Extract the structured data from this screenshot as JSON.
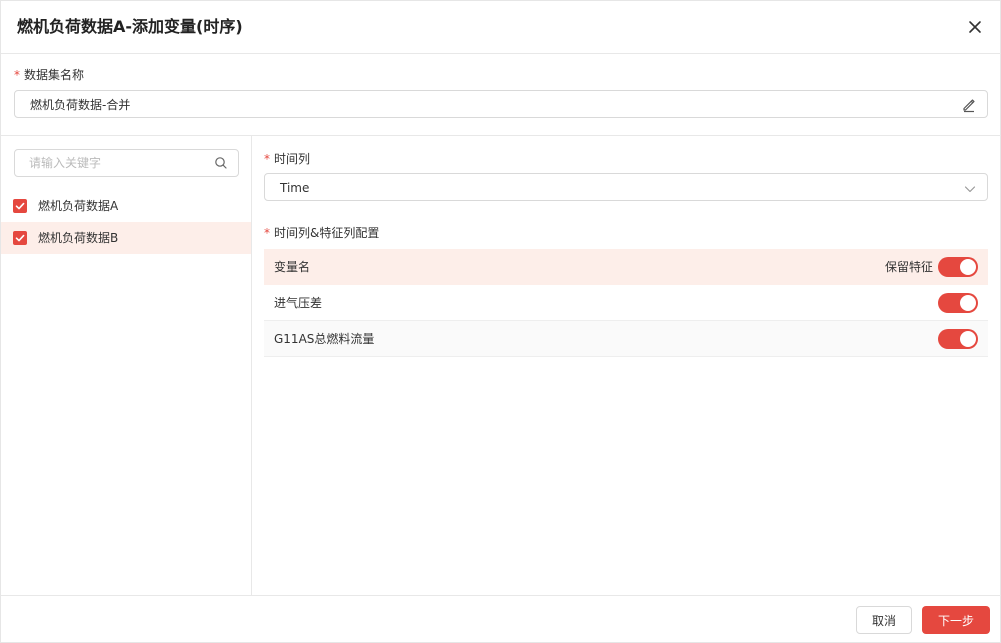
{
  "dialog": {
    "title": "燃机负荷数据A-添加变量(时序)",
    "close_icon": "close-icon"
  },
  "dataset": {
    "required_mark": "*",
    "label": "数据集名称",
    "value": "燃机负荷数据-合并",
    "edit_icon": "edit-icon"
  },
  "left": {
    "search_placeholder": "请输入关键字",
    "search_icon": "search-icon",
    "items": [
      {
        "label": "燃机负荷数据A",
        "checked": true,
        "active": false
      },
      {
        "label": "燃机负荷数据B",
        "checked": true,
        "active": true
      }
    ]
  },
  "right": {
    "time_column": {
      "required_mark": "*",
      "label": "时间列",
      "value": "Time",
      "chevron_icon": "chevron-down-icon"
    },
    "config": {
      "required_mark": "*",
      "label": "时间列&特征列配置",
      "header": {
        "name": "变量名",
        "keep_label": "保留特征",
        "keep_all": true
      },
      "rows": [
        {
          "name": "进气压差",
          "keep": true
        },
        {
          "name": "G11AS总燃料流量",
          "keep": true
        }
      ]
    }
  },
  "footer": {
    "cancel_label": "取消",
    "next_label": "下一步"
  },
  "colors": {
    "accent": "#e5483f",
    "highlight_bg": "#fdeee9"
  }
}
